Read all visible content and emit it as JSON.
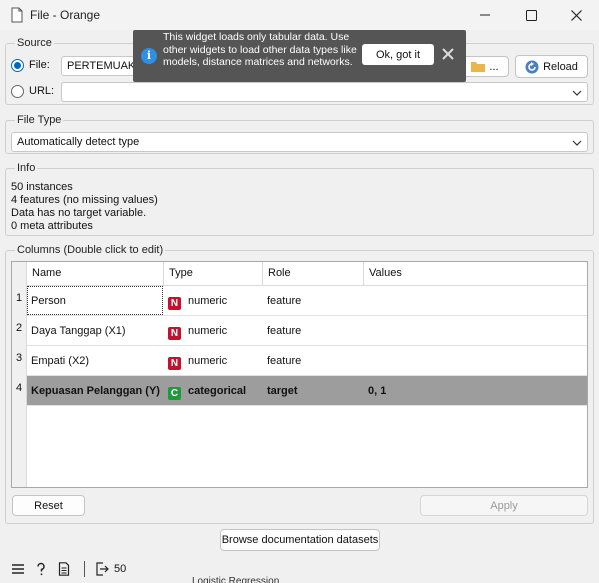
{
  "window": {
    "title": "File - Orange"
  },
  "notification": {
    "text": "This widget loads only tabular data. Use other widgets to load other data types like models, distance matrices and networks.",
    "ok_label": "Ok, got it"
  },
  "source": {
    "title": "Source",
    "file_label": "File:",
    "file_value": "PERTEMUAK K",
    "browse_label": "...",
    "reload_label": "Reload",
    "url_label": "URL:",
    "url_value": ""
  },
  "file_type": {
    "title": "File Type",
    "value": "Automatically detect type"
  },
  "info": {
    "title": "Info",
    "lines": [
      "50 instances",
      "4 features (no missing values)",
      "Data has no target variable.",
      "0 meta attributes"
    ]
  },
  "columns": {
    "title": "Columns (Double click to edit)",
    "headers": [
      "Name",
      "Type",
      "Role",
      "Values"
    ],
    "rows": [
      {
        "num": "1",
        "name": "Person",
        "type_badge": "N",
        "type": "numeric",
        "role": "feature",
        "values": ""
      },
      {
        "num": "2",
        "name": "Daya Tanggap (X1)",
        "type_badge": "N",
        "type": "numeric",
        "role": "feature",
        "values": ""
      },
      {
        "num": "3",
        "name": "Empati (X2)",
        "type_badge": "N",
        "type": "numeric",
        "role": "feature",
        "values": ""
      },
      {
        "num": "4",
        "name": "Kepuasan Pelanggan (Y)",
        "type_badge": "C",
        "type": "categorical",
        "role": "target",
        "values": "0, 1"
      }
    ],
    "badge_colors": {
      "N": "#c4122e",
      "C": "#1f9a3a"
    }
  },
  "buttons": {
    "reset": "Reset",
    "apply": "Apply",
    "browse_docs": "Browse documentation datasets"
  },
  "status": {
    "output_count": "50",
    "behind_text": "Logistic Regression"
  }
}
